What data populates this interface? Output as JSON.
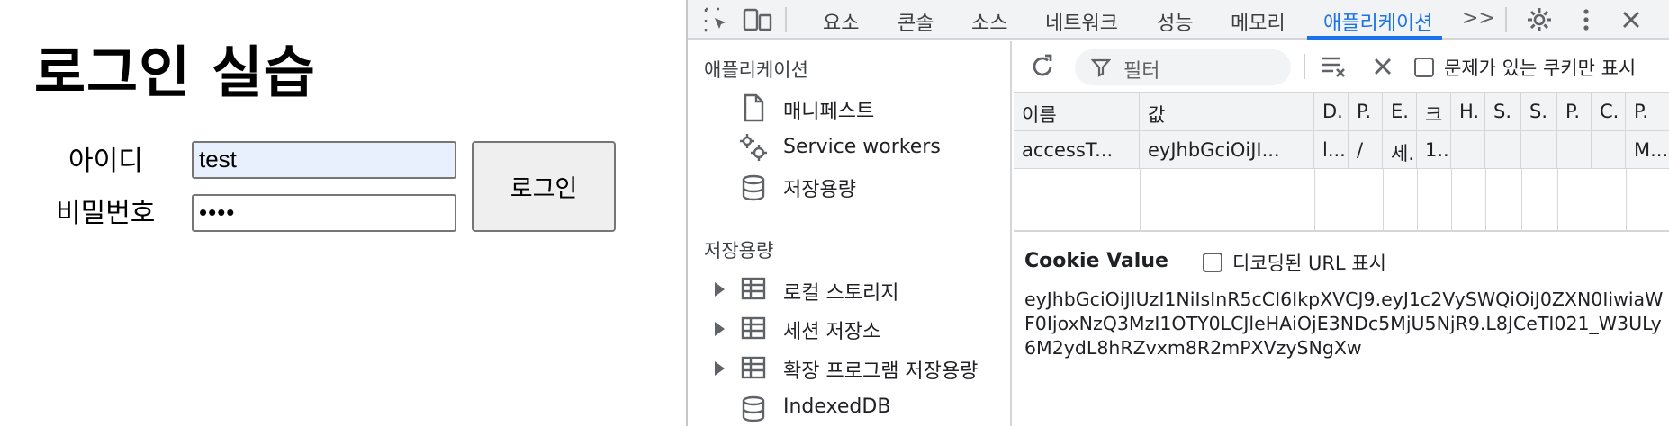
{
  "page": {
    "title": "로그인 실습",
    "id_label": "아이디",
    "pw_label": "비밀번호",
    "id_value": "test",
    "pw_value": "••••",
    "login_button": "로그인"
  },
  "devtools": {
    "tabs": [
      "요소",
      "콘솔",
      "소스",
      "네트워크",
      "성능",
      "메모리",
      "애플리케이션"
    ],
    "more_tabs_label": ">>",
    "active_tab": "애플리케이션",
    "accent_color": "#1a73e8",
    "sidebar": {
      "app_header": "애플리케이션",
      "app_items": [
        {
          "label": "매니페스트",
          "icon": "file-icon"
        },
        {
          "label": "Service workers",
          "icon": "gears-icon"
        },
        {
          "label": "저장용량",
          "icon": "database-icon"
        }
      ],
      "storage_header": "저장용량",
      "storage_items": [
        {
          "label": "로컬 스토리지",
          "icon": "table-icon"
        },
        {
          "label": "세션 저장소",
          "icon": "table-icon"
        },
        {
          "label": "확장 프로그램 저장용량",
          "icon": "table-icon"
        },
        {
          "label": "IndexedDB",
          "icon": "database-icon"
        }
      ]
    },
    "toolbar": {
      "filter_placeholder": "필터",
      "only_issues_label": "문제가 있는 쿠키만 표시"
    },
    "cookie_table": {
      "headers": [
        "이름",
        "값",
        "D.",
        "P.",
        "E.",
        "크",
        "H.",
        "S.",
        "S.",
        "P.",
        "C.",
        "P."
      ],
      "rows": [
        [
          "accessT...",
          "eyJhbGciOiJI...",
          "l...",
          "/",
          "세...",
          "1...",
          "",
          "",
          "",
          "",
          "",
          "M..."
        ]
      ]
    },
    "cookie_value": {
      "title": "Cookie Value",
      "decode_label": "디코딩된 URL 표시",
      "value": "eyJhbGciOiJIUzI1NiIsInR5cCI6IkpXVCJ9.eyJ1c2VySWQiOiJ0ZXN0IiwiaWF0IjoxNzQ3MzI1OTY0LCJleHAiOjE3NDc5MjU5NjR9.L8JCeTI021_W3ULy6M2ydL8hRZvxm8R2mPXVzySNgXw"
    }
  }
}
